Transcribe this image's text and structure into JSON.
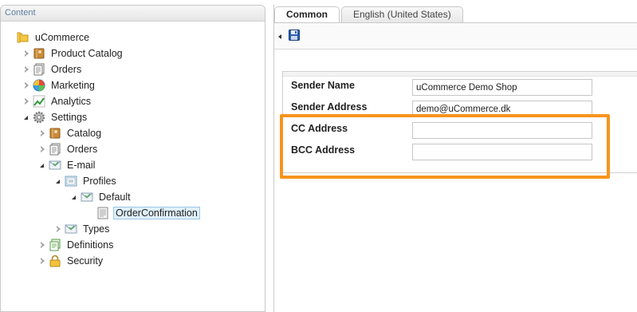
{
  "left_panel": {
    "title": "Content",
    "tree": [
      {
        "label": "uCommerce",
        "icon": "folder-icon",
        "level": 0,
        "arrow": "none"
      },
      {
        "label": "Product Catalog",
        "icon": "catalog-icon",
        "level": 1,
        "arrow": "closed"
      },
      {
        "label": "Orders",
        "icon": "orders-icon",
        "level": 1,
        "arrow": "closed"
      },
      {
        "label": "Marketing",
        "icon": "marketing-globe-icon",
        "level": 1,
        "arrow": "closed"
      },
      {
        "label": "Analytics",
        "icon": "analytics-chart-icon",
        "level": 1,
        "arrow": "closed"
      },
      {
        "label": "Settings",
        "icon": "settings-gear-icon",
        "level": 1,
        "arrow": "open"
      },
      {
        "label": "Catalog",
        "icon": "catalog-icon",
        "level": 2,
        "arrow": "closed"
      },
      {
        "label": "Orders",
        "icon": "orders-icon",
        "level": 2,
        "arrow": "closed"
      },
      {
        "label": "E-mail",
        "icon": "email-icon",
        "level": 2,
        "arrow": "open"
      },
      {
        "label": "Profiles",
        "icon": "profiles-icon",
        "level": 3,
        "arrow": "open"
      },
      {
        "label": "Default",
        "icon": "email-icon",
        "level": 4,
        "arrow": "open"
      },
      {
        "label": "OrderConfirmation",
        "icon": "document-icon",
        "level": 5,
        "arrow": "none",
        "selected": true
      },
      {
        "label": "Types",
        "icon": "email-icon",
        "level": 3,
        "arrow": "closed"
      },
      {
        "label": "Definitions",
        "icon": "definitions-icon",
        "level": 2,
        "arrow": "closed"
      },
      {
        "label": "Security",
        "icon": "lock-icon",
        "level": 2,
        "arrow": "closed"
      }
    ]
  },
  "tabs": [
    {
      "label": "Common",
      "active": true
    },
    {
      "label": "English (United States)",
      "active": false
    }
  ],
  "toolbar": {
    "back_icon": "back-arrow-icon",
    "save_icon": "save-disk-icon"
  },
  "form": {
    "sender_name": {
      "label": "Sender Name",
      "value": "uCommerce Demo Shop"
    },
    "sender_address": {
      "label": "Sender Address",
      "value": "demo@uCommerce.dk"
    },
    "cc_address": {
      "label": "CC Address",
      "value": ""
    },
    "bcc_address": {
      "label": "BCC Address",
      "value": ""
    }
  },
  "colors": {
    "highlight": "#f7941e",
    "panel_title": "#5b7fa5",
    "selection": "#dff0fb"
  }
}
